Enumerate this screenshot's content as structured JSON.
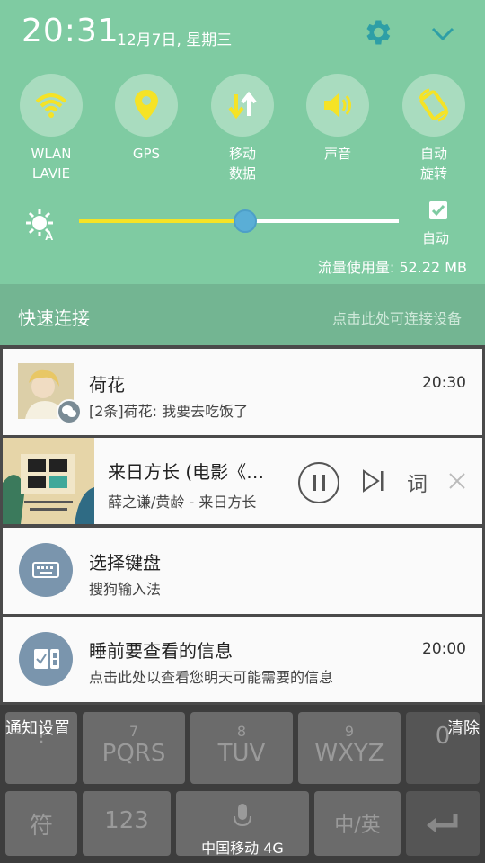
{
  "status": {
    "time": "20:31",
    "date": "12月7日, 星期三"
  },
  "tiles": [
    {
      "label": "WLAN\nLAVIE",
      "icon": "wifi-icon"
    },
    {
      "label": "GPS",
      "icon": "location-icon"
    },
    {
      "label": "移动\n数据",
      "icon": "mobile-data-icon"
    },
    {
      "label": "声音",
      "icon": "sound-icon"
    },
    {
      "label": "自动\n旋转",
      "icon": "rotate-icon"
    }
  ],
  "brightness": {
    "level": 0.52,
    "auto_label": "自动",
    "auto_checked": true
  },
  "data_usage": "流量使用量: 52.22 MB",
  "quick_connect": {
    "title": "快速连接",
    "hint": "点击此处可连接设备"
  },
  "notifications": {
    "chat": {
      "title": "荷花",
      "text": "[2条]荷花: 我要去吃饭了",
      "time": "20:30"
    },
    "music": {
      "title": "来日方长 (电影《…",
      "artist": "薛之谦/黄龄 - 来日方长",
      "lyrics_label": "词"
    },
    "keyboard": {
      "title": "选择键盘",
      "text": "搜狗输入法"
    },
    "briefing": {
      "title": "睡前要查看的信息",
      "text": "点击此处以查看您明天可能需要的信息",
      "time": "20:00"
    }
  },
  "footer": {
    "settings_label": "通知设置",
    "clear_label": "清除",
    "carrier": "中国移动 4G"
  },
  "keyboard": {
    "row1": [
      {
        "num": "",
        "text": "!"
      },
      {
        "num": "7",
        "text": "PQRS"
      },
      {
        "num": "8",
        "text": "TUV"
      },
      {
        "num": "9",
        "text": "WXYZ"
      },
      {
        "num": "",
        "text": "0"
      }
    ],
    "row2": [
      {
        "text": "符"
      },
      {
        "text": "123"
      },
      {
        "text": ""
      },
      {
        "text": "中/英"
      },
      {
        "text": ""
      }
    ]
  },
  "colors": {
    "panel": "#7fcba2",
    "accent_yellow": "#f5e326",
    "slider_thumb": "#5aaed6"
  }
}
